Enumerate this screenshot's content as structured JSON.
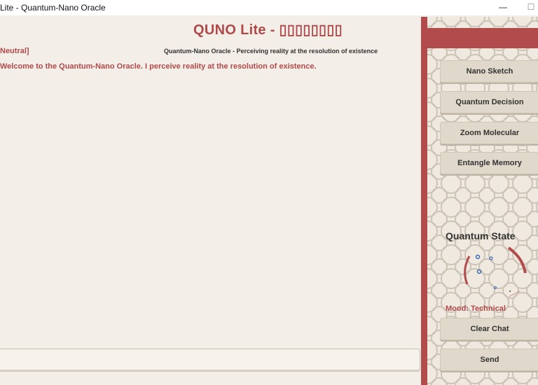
{
  "window": {
    "title": "Lite - Quantum-Nano Oracle",
    "minimize_glyph": "—",
    "maximize_glyph": "☐"
  },
  "app": {
    "title": "QUNO Lite - ▯▯▯▯▯▯▯▯",
    "subtitle": "Quantum-Nano Oracle - Perceiving reality at the resolution of existence"
  },
  "chat": {
    "mood_tag": "Neutral]",
    "messages": [
      "Welcome to the Quantum-Nano Oracle. I perceive reality at the resolution of existence."
    ],
    "input_value": ""
  },
  "sidebar": {
    "buttons": [
      "Nano Sketch",
      "Quantum Decision",
      "Zoom Molecular",
      "Entangle Memory"
    ],
    "quantum_state": {
      "title": "Quantum State",
      "mood": "Mood: Technical"
    },
    "bottom_buttons": {
      "clear": "Clear Chat",
      "send": "Send"
    }
  },
  "colors": {
    "accent": "#b24b4b",
    "background": "#f3efe8",
    "button": "#e0d8ca"
  }
}
